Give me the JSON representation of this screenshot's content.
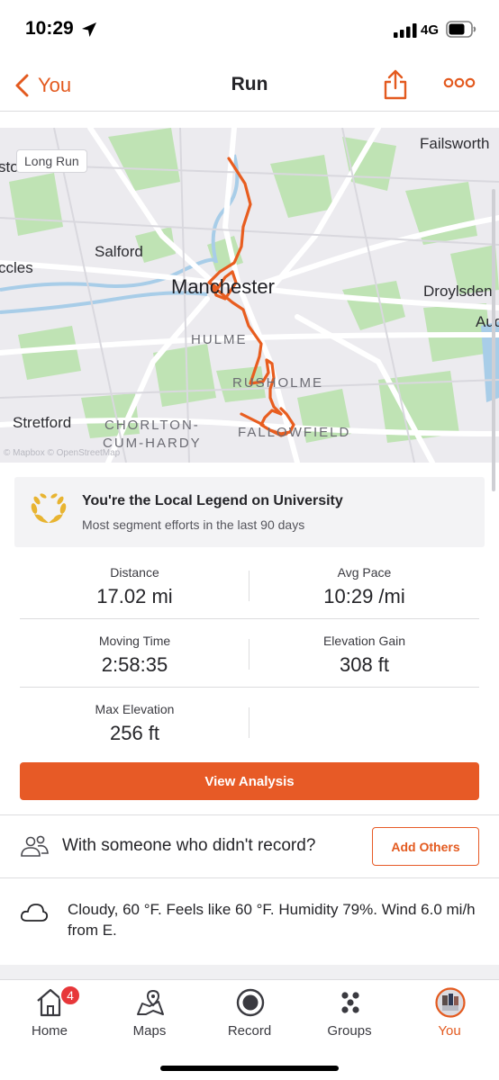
{
  "status_bar": {
    "time": "10:29",
    "network": "4G"
  },
  "nav": {
    "back_label": "You",
    "title": "Run"
  },
  "map": {
    "badge": "Long Run",
    "labels": {
      "failsworth": "Failsworth",
      "eton": "ston",
      "salford": "Salford",
      "eccles": "ccles",
      "manchester": "Manchester",
      "droylsden": "Droylsden",
      "aud": "Aud",
      "hulme": "HULME",
      "rusholme": "RUSHOLME",
      "stretford": "Stretford",
      "chorlton": "CHORLTON-",
      "cum_hardy": "CUM-HARDY",
      "fallowfield": "FALLOWFIELD"
    },
    "attribution": "© Mapbox © OpenStreetMap",
    "route_color": "#e85d1f"
  },
  "legend": {
    "title": "You're the Local Legend on University",
    "subtitle": "Most segment efforts in the last 90 days",
    "laurel_color": "#e8b431"
  },
  "stats": {
    "distance_label": "Distance",
    "distance_value": "17.02 mi",
    "pace_label": "Avg Pace",
    "pace_value": "10:29 /mi",
    "moving_label": "Moving Time",
    "moving_value": "2:58:35",
    "elev_gain_label": "Elevation Gain",
    "elev_gain_value": "308 ft",
    "max_elev_label": "Max Elevation",
    "max_elev_value": "256 ft"
  },
  "analysis_button": "View Analysis",
  "with_someone": {
    "text": "With someone who didn't record?",
    "button": "Add Others"
  },
  "weather": {
    "text": "Cloudy, 60 °F. Feels like 60 °F. Humidity 79%. Wind 6.0 mi/h from E."
  },
  "tabs": [
    {
      "label": "Home",
      "icon": "home-icon",
      "badge": "4"
    },
    {
      "label": "Maps",
      "icon": "maps-icon"
    },
    {
      "label": "Record",
      "icon": "record-icon"
    },
    {
      "label": "Groups",
      "icon": "groups-icon"
    },
    {
      "label": "You",
      "icon": "profile-avatar",
      "active": true
    }
  ],
  "accent_color": "#e75a26"
}
